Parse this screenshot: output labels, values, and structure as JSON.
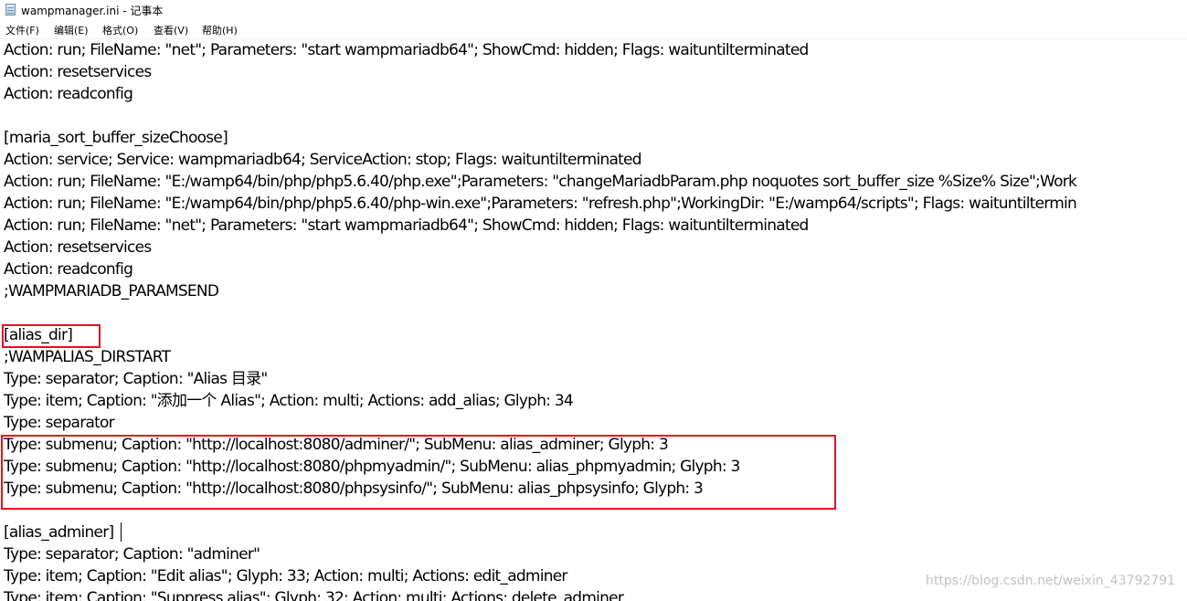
{
  "window": {
    "title": "wampmanager.ini - 记事本",
    "icon": "notepad-icon"
  },
  "menu": [
    "文件(F)",
    "编辑(E)",
    "格式(O)",
    "查看(V)",
    "帮助(H)"
  ],
  "editor": {
    "lines": [
      "Action: run; FileName: \"net\"; Parameters: \"start wampmariadb64\"; ShowCmd: hidden; Flags: waituntilterminated",
      "Action: resetservices",
      "Action: readconfig",
      "",
      "[maria_sort_buffer_sizeChoose]",
      "Action: service; Service: wampmariadb64; ServiceAction: stop; Flags: waituntilterminated",
      "Action: run; FileName: \"E:/wamp64/bin/php/php5.6.40/php.exe\";Parameters: \"changeMariadbParam.php noquotes sort_buffer_size %Size% Size\";Work",
      "Action: run; FileName: \"E:/wamp64/bin/php/php5.6.40/php-win.exe\";Parameters: \"refresh.php\";WorkingDir: \"E:/wamp64/scripts\"; Flags: waituntiltermin",
      "Action: run; FileName: \"net\"; Parameters: \"start wampmariadb64\"; ShowCmd: hidden; Flags: waituntilterminated",
      "Action: resetservices",
      "Action: readconfig",
      ";WAMPMARIADB_PARAMSEND",
      "",
      "[alias_dir]",
      ";WAMPALIAS_DIRSTART",
      "Type: separator; Caption: \"Alias 目录\"",
      "Type: item; Caption: \"添加一个 Alias\"; Action: multi; Actions: add_alias; Glyph: 34",
      "Type: separator",
      "Type: submenu; Caption: \"http://localhost:8080/adminer/\"; SubMenu: alias_adminer; Glyph: 3",
      "Type: submenu; Caption: \"http://localhost:8080/phpmyadmin/\"; SubMenu: alias_phpmyadmin; Glyph: 3",
      "Type: submenu; Caption: \"http://localhost:8080/phpsysinfo/\"; SubMenu: alias_phpsysinfo; Glyph: 3",
      "",
      "[alias_adminer]",
      "Type: separator; Caption: \"adminer\"",
      "Type: item; Caption: \"Edit alias\"; Glyph: 33; Action: multi; Actions: edit_adminer",
      "Type: item; Caption: \"Suppress alias\"; Glyph: 32; Action: multi; Actions: delete_adminer"
    ]
  },
  "watermark": "https://blog.csdn.net/weixin_43792791",
  "colors": {
    "highlight": "#e0141a"
  }
}
